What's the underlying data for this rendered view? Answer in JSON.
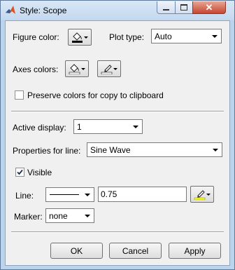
{
  "window": {
    "title": "Style: Scope"
  },
  "figure": {
    "label": "Figure color:"
  },
  "plot_type": {
    "label": "Plot type:",
    "value": "Auto"
  },
  "axes": {
    "label": "Axes colors:"
  },
  "preserve": {
    "label": "Preserve colors for copy to clipboard",
    "checked": false
  },
  "active_display": {
    "label": "Active display:",
    "value": "1"
  },
  "properties": {
    "label": "Properties for line:",
    "value": "Sine Wave"
  },
  "visible": {
    "label": "Visible",
    "checked": true
  },
  "line": {
    "label": "Line:",
    "width": "0.75",
    "color": "#ffff00"
  },
  "marker": {
    "label": "Marker:",
    "value": "none"
  },
  "buttons": {
    "ok": "OK",
    "cancel": "Cancel",
    "apply": "Apply"
  },
  "icons": {
    "app": "matlab-icon",
    "figure_color": "paint-bucket-icon",
    "axes_background": "paint-bucket-icon",
    "axes_foreground": "pen-icon",
    "line_color": "pen-icon"
  }
}
